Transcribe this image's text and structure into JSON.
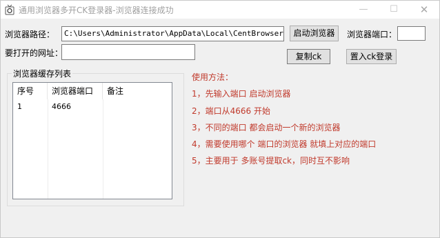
{
  "window": {
    "title": "通用浏览器多开CK登录器-浏览器连接成功",
    "controls": {
      "minimize": "—",
      "maximize": "☐",
      "close": "✕"
    }
  },
  "form": {
    "browser_path_label": "浏览器路径：",
    "browser_path_value": "C:\\Users\\Administrator\\AppData\\Local\\CentBrowser\\Appl",
    "start_browser_button": "启动浏览器",
    "browser_port_label": "浏览器端口：",
    "browser_port_value": "",
    "url_label": "要打开的网址：",
    "url_value": "",
    "copy_ck_button": "复制ck",
    "import_ck_button": "置入ck登录"
  },
  "cache_list": {
    "group_title": "浏览器缓存列表",
    "columns": [
      "序号",
      "浏览器端口",
      "备注"
    ],
    "rows": [
      {
        "index": "1",
        "port": "4666",
        "note": ""
      }
    ]
  },
  "instructions": {
    "heading": "使用方法：",
    "steps": [
      "1，先输入端口 启动浏览器",
      "2，端口从4666 开始",
      "3，不同的端口 都会启动一个新的浏览器",
      "4，需要使用哪个 端口的浏览器  就填上对应的端口",
      "5，主要用于 多账号提取ck，同时互不影响"
    ]
  }
}
